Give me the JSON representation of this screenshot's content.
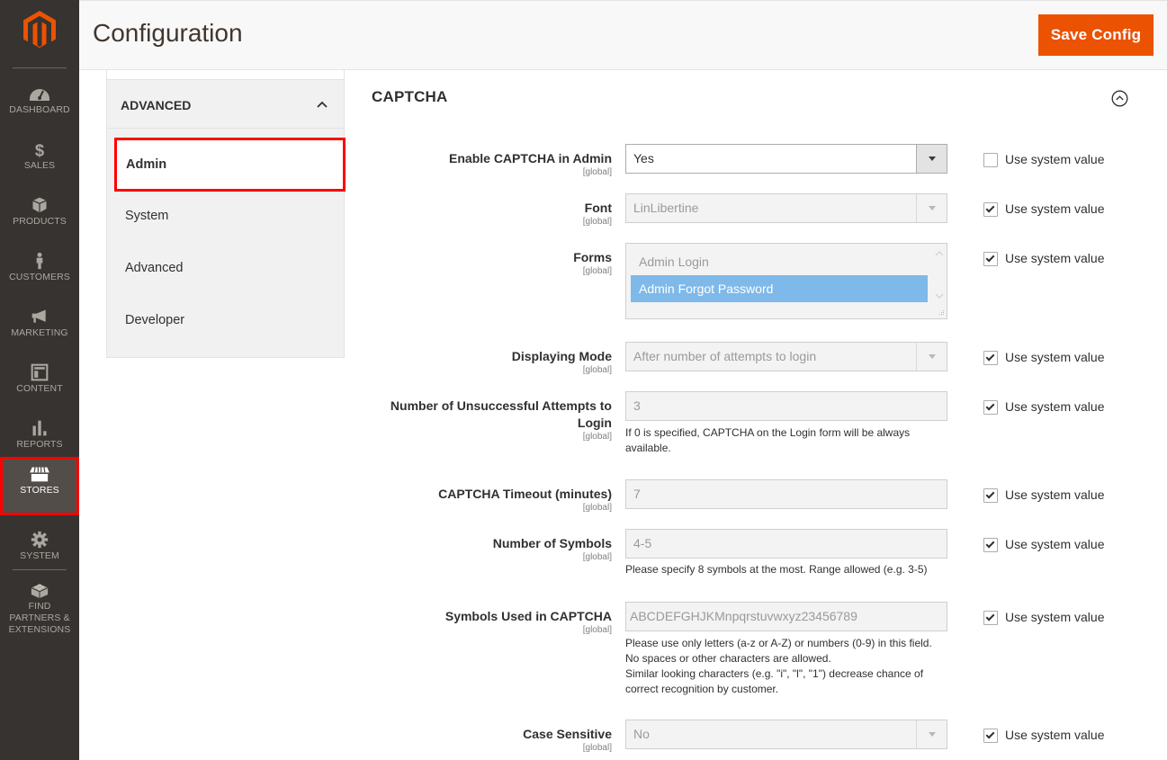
{
  "nav": {
    "items": [
      {
        "label": "DASHBOARD",
        "icon": "dashboard-gauge-icon"
      },
      {
        "label": "SALES",
        "icon": "dollar-icon"
      },
      {
        "label": "PRODUCTS",
        "icon": "box-icon"
      },
      {
        "label": "CUSTOMERS",
        "icon": "person-icon"
      },
      {
        "label": "MARKETING",
        "icon": "megaphone-icon"
      },
      {
        "label": "CONTENT",
        "icon": "layout-icon"
      },
      {
        "label": "REPORTS",
        "icon": "bar-chart-icon"
      },
      {
        "label": "STORES",
        "icon": "storefront-icon",
        "active": true
      },
      {
        "label": "SYSTEM",
        "icon": "gear-icon"
      },
      {
        "label": "FIND PARTNERS & EXTENSIONS",
        "icon": "lego-brick-icon"
      }
    ]
  },
  "header": {
    "title": "Configuration",
    "save_label": "Save Config"
  },
  "sidebar": {
    "group_label": "ADVANCED",
    "items": [
      {
        "label": "Admin",
        "active": true
      },
      {
        "label": "System"
      },
      {
        "label": "Advanced"
      },
      {
        "label": "Developer"
      }
    ]
  },
  "section": {
    "title": "CAPTCHA",
    "use_system_label": "Use system value",
    "fields": [
      {
        "label": "Enable CAPTCHA in Admin",
        "scope": "[global]",
        "type": "select",
        "value": "Yes",
        "use_system": false
      },
      {
        "label": "Font",
        "scope": "[global]",
        "type": "select",
        "value": "LinLibertine",
        "use_system": true
      },
      {
        "label": "Forms",
        "scope": "[global]",
        "type": "multiselect",
        "options": [
          "Admin Login",
          "Admin Forgot Password"
        ],
        "selected": [
          "Admin Forgot Password"
        ],
        "use_system": true
      },
      {
        "label": "Displaying Mode",
        "scope": "[global]",
        "type": "select",
        "value": "After number of attempts to login",
        "use_system": true
      },
      {
        "label": "Number of Unsuccessful Attempts to Login",
        "scope": "[global]",
        "type": "text",
        "value": "3",
        "note": "If 0 is specified, CAPTCHA on the Login form will be always available.",
        "use_system": true
      },
      {
        "label": "CAPTCHA Timeout (minutes)",
        "scope": "[global]",
        "type": "text",
        "value": "7",
        "use_system": true
      },
      {
        "label": "Number of Symbols",
        "scope": "[global]",
        "type": "text",
        "value": "4-5",
        "note": "Please specify 8 symbols at the most. Range allowed (e.g. 3-5)",
        "use_system": true
      },
      {
        "label": "Symbols Used in CAPTCHA",
        "scope": "[global]",
        "type": "text",
        "value": "ABCDEFGHJKMnpqrstuvwxyz23456789",
        "note_lines": [
          "Please use only letters (a-z or A-Z) or numbers (0-9) in this field.",
          "No spaces or other characters are allowed.",
          "Similar looking characters (e.g. \"i\", \"l\", \"1\") decrease chance of correct recognition by customer."
        ],
        "use_system": true
      },
      {
        "label": "Case Sensitive",
        "scope": "[global]",
        "type": "select",
        "value": "No",
        "use_system": true
      }
    ]
  },
  "colors": {
    "accent": "#eb5202",
    "nav_bg": "#373330",
    "highlight": "#ff0000",
    "selected_option": "#7fb9e9"
  }
}
